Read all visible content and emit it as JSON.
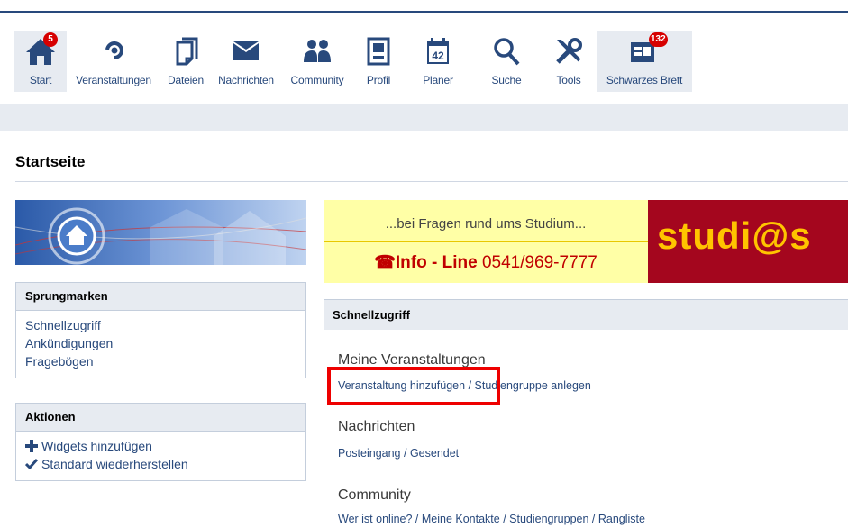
{
  "nav": {
    "items": [
      {
        "label": "Start",
        "icon": "home-icon",
        "badge": "5"
      },
      {
        "label": "Veranstaltungen",
        "icon": "seminar-icon"
      },
      {
        "label": "Dateien",
        "icon": "files-icon"
      },
      {
        "label": "Nachrichten",
        "icon": "mail-icon"
      },
      {
        "label": "Community",
        "icon": "community-icon"
      },
      {
        "label": "Profil",
        "icon": "profile-icon"
      },
      {
        "label": "Planer",
        "icon": "calendar-icon",
        "date": "42"
      },
      {
        "label": "Suche",
        "icon": "search-icon"
      },
      {
        "label": "Tools",
        "icon": "tools-icon"
      },
      {
        "label": "Schwarzes Brett",
        "icon": "board-icon",
        "badge": "132"
      }
    ]
  },
  "page": {
    "title": "Startseite"
  },
  "sidebar": {
    "jump": {
      "title": "Sprungmarken",
      "links": [
        "Schnellzugriff",
        "Ankündigungen",
        "Fragebögen"
      ]
    },
    "actions": {
      "title": "Aktionen",
      "items": [
        "Widgets hinzufügen",
        "Standard wiederherstellen"
      ]
    }
  },
  "ad": {
    "question": "...bei Fragen rund ums Studium...",
    "info_label": "Info - Line",
    "info_number": "0541/969-7777",
    "logo": "studi@s"
  },
  "quick": {
    "title": "Schnellzugriff",
    "sections": [
      {
        "title": "Meine Veranstaltungen",
        "links": [
          "Veranstaltung hinzufügen",
          "Studiengruppe anlegen"
        ]
      },
      {
        "title": "Nachrichten",
        "links": [
          "Posteingang",
          "Gesendet"
        ]
      },
      {
        "title": "Community",
        "links": [
          "Wer ist online?",
          "Meine Kontakte",
          "Studiengruppen",
          "Rangliste"
        ]
      }
    ]
  },
  "colors": {
    "brand": "#28497c",
    "highlight": "#ee0000",
    "panel": "#e7ebf1"
  }
}
